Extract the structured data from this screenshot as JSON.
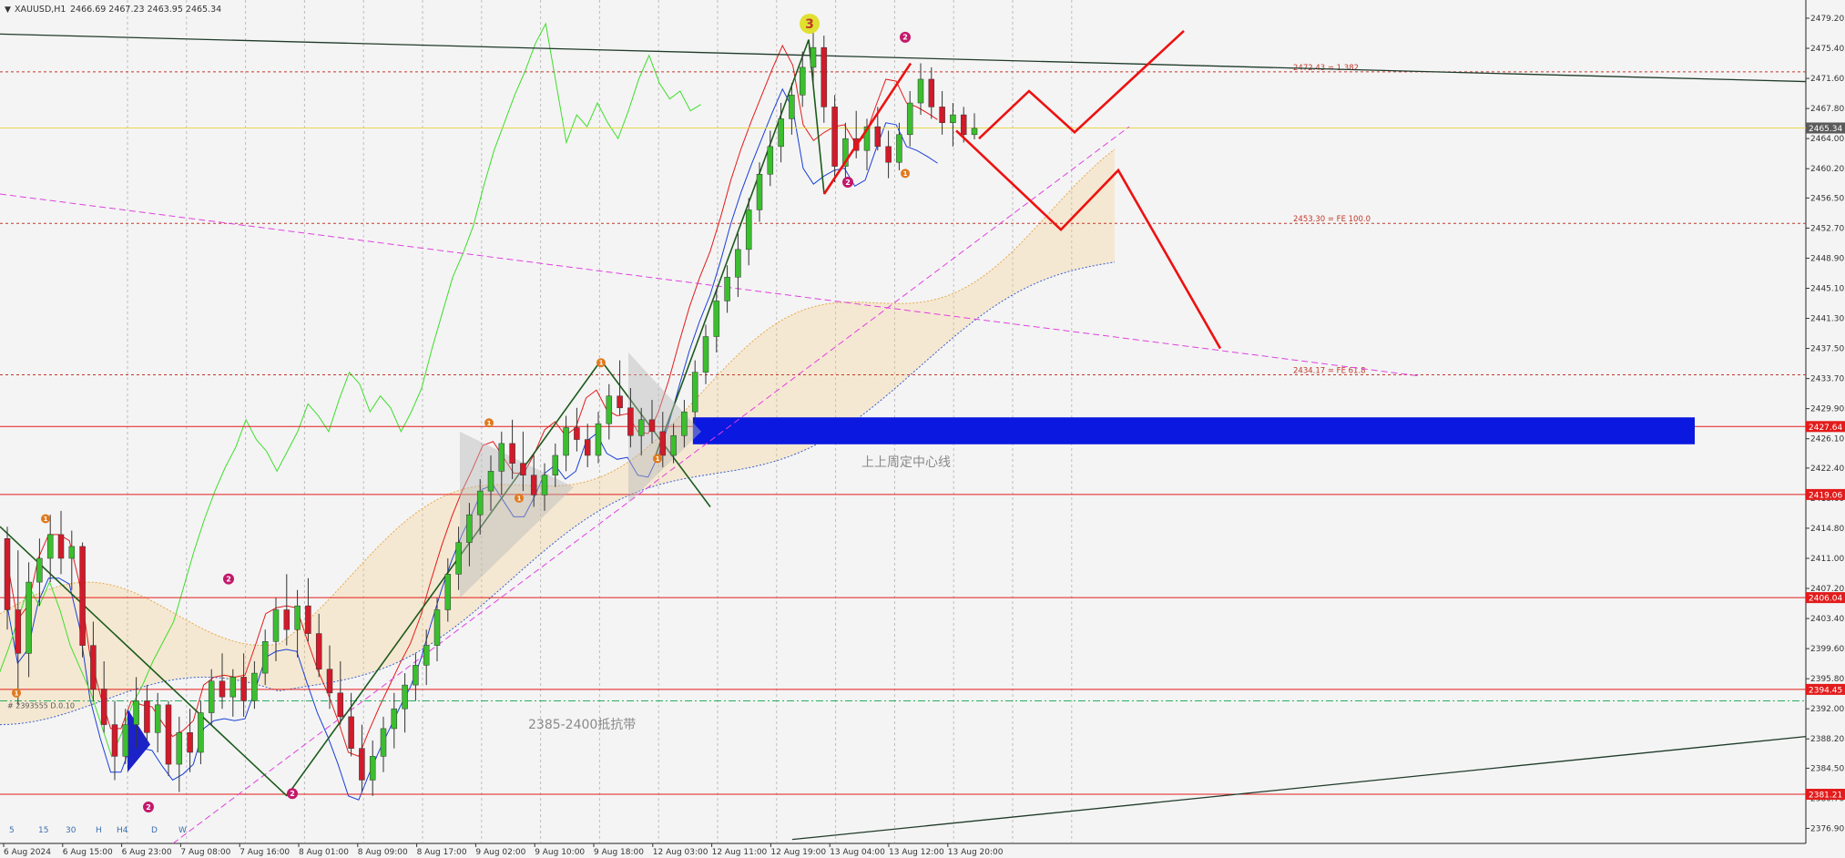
{
  "header": {
    "symbol": "XAUUSD,H1",
    "ohlc": "2466.69 2467.23 2463.95 2465.34"
  },
  "chart_data": {
    "type": "candlestick",
    "y_range": [
      2375.0,
      2481.5
    ],
    "x_range": [
      0,
      170
    ],
    "bar_width_note": "H1 candles",
    "y_ticks": [
      "2479.20",
      "2475.40",
      "2471.60",
      "2467.80",
      "2464.00",
      "2460.20",
      "2456.50",
      "2452.70",
      "2448.90",
      "2445.10",
      "2441.30",
      "2437.50",
      "2433.70",
      "2429.90",
      "2426.10",
      "2422.40",
      "2418.60",
      "2414.80",
      "2411.00",
      "2407.20",
      "2403.40",
      "2399.60",
      "2395.80",
      "2392.00",
      "2388.20",
      "2384.50",
      "2380.70",
      "2376.90"
    ],
    "x_ticks": [
      {
        "label": "6 Aug 2024",
        "x": 0
      },
      {
        "label": "6 Aug 15:00",
        "x": 8
      },
      {
        "label": "6 Aug 23:00",
        "x": 16
      },
      {
        "label": "7 Aug 08:00",
        "x": 24
      },
      {
        "label": "7 Aug 16:00",
        "x": 32
      },
      {
        "label": "8 Aug 01:00",
        "x": 40
      },
      {
        "label": "8 Aug 09:00",
        "x": 48
      },
      {
        "label": "8 Aug 17:00",
        "x": 56
      },
      {
        "label": "9 Aug 02:00",
        "x": 64
      },
      {
        "label": "9 Aug 10:00",
        "x": 72
      },
      {
        "label": "9 Aug 18:00",
        "x": 80
      },
      {
        "label": "12 Aug 03:00",
        "x": 88
      },
      {
        "label": "12 Aug 11:00",
        "x": 96
      },
      {
        "label": "12 Aug 19:00",
        "x": 104
      },
      {
        "label": "13 Aug 04:00",
        "x": 112
      },
      {
        "label": "13 Aug 12:00",
        "x": 120
      },
      {
        "label": "13 Aug 20:00",
        "x": 128
      }
    ],
    "timeframe_labels": [
      "5",
      "15",
      "30",
      "H",
      "H4",
      "D",
      "W"
    ],
    "price_tags": [
      {
        "label": "2465.34",
        "price": 2465.34,
        "bg": "#5a5a5a",
        "fg": "#ffffff"
      },
      {
        "label": "2427.64",
        "price": 2427.64,
        "bg": "#e31b1b",
        "fg": "#ffffff"
      },
      {
        "label": "2419.06",
        "price": 2419.06,
        "bg": "#e31b1b",
        "fg": "#ffffff"
      },
      {
        "label": "2406.04",
        "price": 2406.04,
        "bg": "#e31b1b",
        "fg": "#ffffff"
      },
      {
        "label": "2394.45",
        "price": 2394.45,
        "bg": "#e31b1b",
        "fg": "#ffffff"
      },
      {
        "label": "2381.21",
        "price": 2381.21,
        "bg": "#e31b1b",
        "fg": "#ffffff"
      }
    ],
    "horizontal_levels": [
      {
        "price": 2465.34,
        "color": "#e8d84a",
        "style": "solid"
      },
      {
        "price": 2427.64,
        "color": "#e31b1b",
        "style": "solid"
      },
      {
        "price": 2419.06,
        "color": "#e31b1b",
        "style": "solid"
      },
      {
        "price": 2406.04,
        "color": "#e31b1b",
        "style": "solid"
      },
      {
        "price": 2394.45,
        "color": "#e31b1b",
        "style": "solid"
      },
      {
        "price": 2381.21,
        "color": "#e31b1b",
        "style": "solid"
      },
      {
        "price": 2472.43,
        "color": "#c0392b",
        "style": "dotted"
      },
      {
        "price": 2453.3,
        "color": "#c0392b",
        "style": "dotted"
      },
      {
        "price": 2434.17,
        "color": "#c0392b",
        "style": "dotted"
      },
      {
        "price": 2393.0,
        "color": "#27ae60",
        "style": "dashdot"
      }
    ],
    "fib_labels": [
      {
        "label": "2472.43 = 1.382",
        "price": 2472.43
      },
      {
        "label": "2453.30 = FE 100.0",
        "price": 2453.3
      },
      {
        "label": "2434.17 = FE 61.8",
        "price": 2434.17
      }
    ],
    "fib_small_label": "# 2393555 D.0.10",
    "annotations": [
      {
        "text": "上上周定中心线",
        "x": 118,
        "price": 2422.6,
        "color": "#8a8a8a"
      },
      {
        "text": "2385-2400抵抗带",
        "x": 71,
        "price": 2389.5,
        "color": "#8a8a8a"
      }
    ],
    "zone": {
      "price_top": 2428.8,
      "price_bottom": 2425.4,
      "x_start": 91,
      "x_end": 180,
      "color": "#0a18e0"
    },
    "wave_labels": [
      {
        "label": "3",
        "x": 108,
        "price": 2478.5,
        "type": "big"
      },
      {
        "label": "2",
        "x": 121,
        "price": 2476.8,
        "type": "pink"
      },
      {
        "label": "2",
        "x": 113,
        "price": 2458.5,
        "type": "pink"
      },
      {
        "label": "2",
        "x": 30,
        "price": 2408.4,
        "type": "pink"
      },
      {
        "label": "2",
        "x": 18,
        "price": 2379.6,
        "type": "pink"
      },
      {
        "label": "2",
        "x": 39,
        "price": 2381.3,
        "type": "pink"
      },
      {
        "label": "1",
        "x": 80,
        "price": 2435.7,
        "type": "orange"
      },
      {
        "label": "1",
        "x": 65,
        "price": 2428.1,
        "type": "orange"
      },
      {
        "label": "1",
        "x": 69,
        "price": 2418.6,
        "type": "orange"
      },
      {
        "label": "1",
        "x": 88,
        "price": 2423.6,
        "type": "orange"
      },
      {
        "label": "1",
        "x": 5,
        "price": 2416.0,
        "type": "orange"
      },
      {
        "label": "1",
        "x": 1,
        "price": 2394.0,
        "type": "orange"
      },
      {
        "label": "1",
        "x": 121,
        "price": 2459.6,
        "type": "orange"
      }
    ],
    "candles": [
      [
        2413.5,
        2415.0,
        2402.0,
        2404.5
      ],
      [
        2404.5,
        2412.0,
        2392.5,
        2399.0
      ],
      [
        2399.0,
        2410.5,
        2396.0,
        2408.0
      ],
      [
        2408.0,
        2413.5,
        2405.0,
        2411.0
      ],
      [
        2411.0,
        2416.5,
        2408.0,
        2414.0
      ],
      [
        2414.0,
        2417.0,
        2409.0,
        2411.0
      ],
      [
        2411.0,
        2414.5,
        2407.0,
        2412.5
      ],
      [
        2412.5,
        2413.0,
        2398.5,
        2400.0
      ],
      [
        2400.0,
        2403.0,
        2393.0,
        2394.5
      ],
      [
        2394.5,
        2398.0,
        2389.0,
        2390.0
      ],
      [
        2390.0,
        2393.0,
        2383.0,
        2386.0
      ],
      [
        2386.0,
        2392.0,
        2385.0,
        2390.0
      ],
      [
        2390.0,
        2396.0,
        2387.0,
        2393.0
      ],
      [
        2393.0,
        2395.0,
        2388.0,
        2389.0
      ],
      [
        2389.0,
        2394.0,
        2386.5,
        2392.5
      ],
      [
        2392.5,
        2393.0,
        2383.5,
        2385.0
      ],
      [
        2385.0,
        2391.0,
        2381.5,
        2389.0
      ],
      [
        2389.0,
        2392.0,
        2384.0,
        2386.5
      ],
      [
        2386.5,
        2393.0,
        2385.0,
        2391.5
      ],
      [
        2391.5,
        2397.0,
        2390.0,
        2395.5
      ],
      [
        2395.5,
        2399.0,
        2392.0,
        2393.5
      ],
      [
        2393.5,
        2397.0,
        2391.0,
        2396.0
      ],
      [
        2396.0,
        2399.0,
        2391.0,
        2393.0
      ],
      [
        2393.0,
        2398.0,
        2392.0,
        2396.5
      ],
      [
        2396.5,
        2402.0,
        2395.0,
        2400.5
      ],
      [
        2400.5,
        2406.0,
        2398.0,
        2404.5
      ],
      [
        2404.5,
        2409.0,
        2400.0,
        2402.0
      ],
      [
        2402.0,
        2407.0,
        2398.5,
        2405.0
      ],
      [
        2405.0,
        2408.5,
        2400.5,
        2401.5
      ],
      [
        2401.5,
        2404.0,
        2396.0,
        2397.0
      ],
      [
        2397.0,
        2400.0,
        2392.0,
        2394.0
      ],
      [
        2394.0,
        2398.0,
        2390.0,
        2391.0
      ],
      [
        2391.0,
        2394.0,
        2386.0,
        2387.0
      ],
      [
        2387.0,
        2390.0,
        2381.5,
        2383.0
      ],
      [
        2383.0,
        2388.0,
        2381.0,
        2386.0
      ],
      [
        2386.0,
        2391.0,
        2384.0,
        2389.5
      ],
      [
        2389.5,
        2394.0,
        2387.0,
        2392.0
      ],
      [
        2392.0,
        2396.5,
        2389.0,
        2395.0
      ],
      [
        2395.0,
        2399.0,
        2393.0,
        2397.5
      ],
      [
        2397.5,
        2402.0,
        2395.0,
        2400.0
      ],
      [
        2400.0,
        2406.0,
        2398.0,
        2404.5
      ],
      [
        2404.5,
        2411.0,
        2403.0,
        2409.0
      ],
      [
        2409.0,
        2415.0,
        2407.0,
        2413.0
      ],
      [
        2413.0,
        2418.0,
        2410.0,
        2416.5
      ],
      [
        2416.5,
        2421.0,
        2414.0,
        2419.5
      ],
      [
        2419.5,
        2424.0,
        2417.0,
        2422.0
      ],
      [
        2422.0,
        2427.0,
        2419.0,
        2425.5
      ],
      [
        2425.5,
        2428.5,
        2421.0,
        2423.0
      ],
      [
        2423.0,
        2427.0,
        2419.5,
        2421.5
      ],
      [
        2421.5,
        2424.0,
        2417.5,
        2419.0
      ],
      [
        2419.0,
        2423.0,
        2417.0,
        2421.5
      ],
      [
        2421.5,
        2425.5,
        2420.0,
        2424.0
      ],
      [
        2424.0,
        2429.0,
        2422.0,
        2427.5
      ],
      [
        2427.5,
        2430.0,
        2424.5,
        2426.0
      ],
      [
        2426.0,
        2428.0,
        2422.5,
        2424.0
      ],
      [
        2424.0,
        2429.5,
        2423.0,
        2428.0
      ],
      [
        2428.0,
        2433.0,
        2426.0,
        2431.5
      ],
      [
        2431.5,
        2436.0,
        2429.0,
        2430.0
      ],
      [
        2430.0,
        2432.5,
        2425.0,
        2426.5
      ],
      [
        2426.5,
        2430.0,
        2424.0,
        2428.5
      ],
      [
        2428.5,
        2431.0,
        2425.5,
        2427.0
      ],
      [
        2427.0,
        2429.5,
        2422.5,
        2424.0
      ],
      [
        2424.0,
        2428.0,
        2423.0,
        2426.5
      ],
      [
        2426.5,
        2431.0,
        2425.0,
        2429.5
      ],
      [
        2429.5,
        2436.0,
        2428.0,
        2434.5
      ],
      [
        2434.5,
        2440.5,
        2433.0,
        2439.0
      ],
      [
        2439.0,
        2445.0,
        2437.0,
        2443.5
      ],
      [
        2443.5,
        2448.0,
        2442.0,
        2446.5
      ],
      [
        2446.5,
        2452.0,
        2444.0,
        2450.0
      ],
      [
        2450.0,
        2456.5,
        2448.0,
        2455.0
      ],
      [
        2455.0,
        2461.0,
        2453.5,
        2459.5
      ],
      [
        2459.5,
        2465.0,
        2458.0,
        2463.0
      ],
      [
        2463.0,
        2468.5,
        2461.0,
        2466.5
      ],
      [
        2466.5,
        2471.0,
        2464.5,
        2469.5
      ],
      [
        2469.5,
        2475.0,
        2468.0,
        2473.0
      ],
      [
        2473.0,
        2477.5,
        2471.0,
        2475.5
      ],
      [
        2475.5,
        2477.0,
        2466.0,
        2468.0
      ],
      [
        2468.0,
        2469.5,
        2458.5,
        2460.5
      ],
      [
        2460.5,
        2466.0,
        2458.0,
        2464.0
      ],
      [
        2464.0,
        2467.5,
        2461.5,
        2462.5
      ],
      [
        2462.5,
        2466.5,
        2460.0,
        2465.5
      ],
      [
        2465.5,
        2468.0,
        2462.5,
        2463.0
      ],
      [
        2463.0,
        2465.0,
        2459.0,
        2461.0
      ],
      [
        2461.0,
        2466.0,
        2460.0,
        2464.5
      ],
      [
        2464.5,
        2470.0,
        2463.0,
        2468.5
      ],
      [
        2468.5,
        2473.5,
        2467.0,
        2471.5
      ],
      [
        2471.5,
        2473.0,
        2466.5,
        2468.0
      ],
      [
        2468.0,
        2470.0,
        2464.5,
        2466.0
      ],
      [
        2466.0,
        2468.5,
        2463.0,
        2467.0
      ],
      [
        2467.0,
        2468.0,
        2463.5,
        2464.5
      ],
      [
        2464.5,
        2467.2,
        2463.9,
        2465.3
      ]
    ]
  }
}
